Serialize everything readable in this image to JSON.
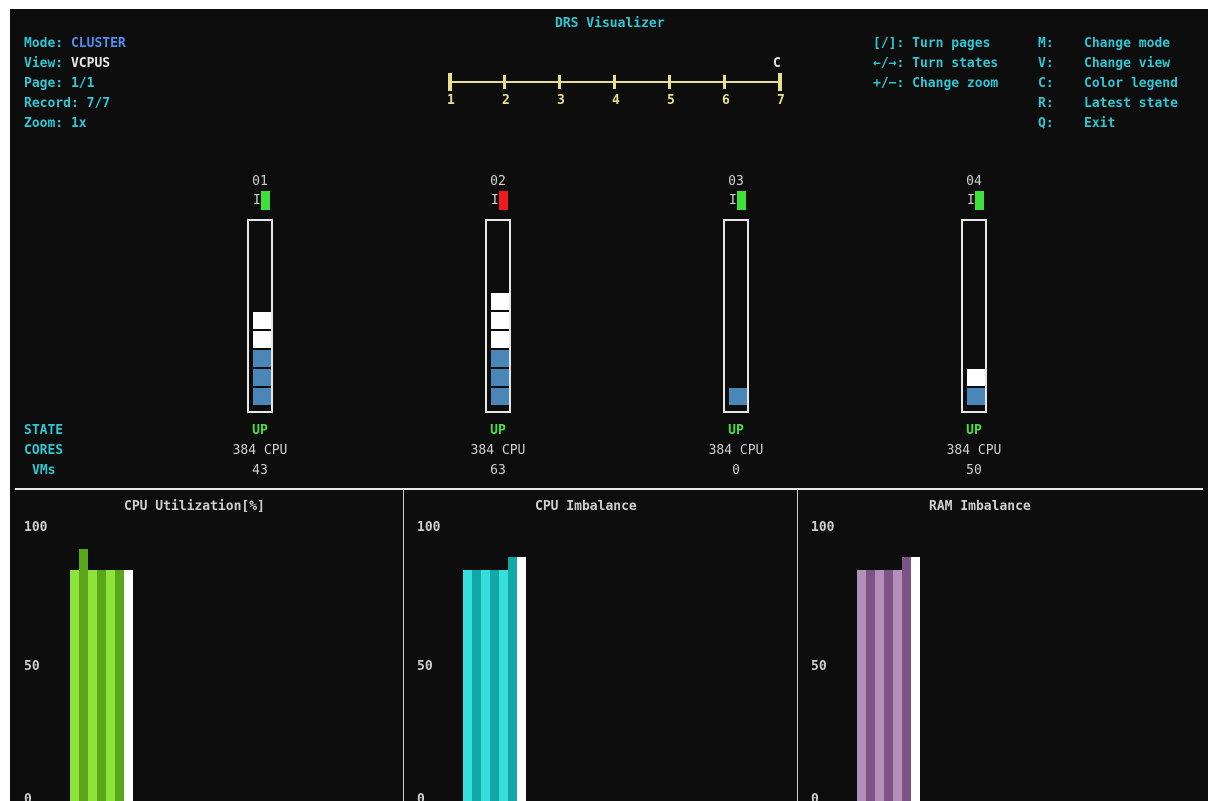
{
  "title": "DRS Visualizer",
  "status": {
    "mode_label": "Mode:",
    "mode_value": "CLUSTER",
    "view_label": "View:",
    "view_value": "VCPUS",
    "page_label": "Page:",
    "page_value": "1/1",
    "record_label": "Record:",
    "record_value": "7/7",
    "zoom_label": "Zoom:",
    "zoom_value": "1x"
  },
  "timeline": {
    "current_marker": "C",
    "ticks": [
      "1",
      "2",
      "3",
      "4",
      "5",
      "6",
      "7"
    ],
    "current_index": 7
  },
  "keys_left": [
    {
      "key": "[/]:",
      "action": "Turn pages"
    },
    {
      "key": "←/→:",
      "action": "Turn states"
    },
    {
      "key": "+/−:",
      "action": "Change zoom"
    }
  ],
  "keys_right": [
    {
      "key": "M:",
      "action": "Change mode"
    },
    {
      "key": "V:",
      "action": "Change view"
    },
    {
      "key": "C:",
      "action": "Color legend"
    },
    {
      "key": "R:",
      "action": "Latest state"
    },
    {
      "key": "Q:",
      "action": "Exit"
    }
  ],
  "row_labels": {
    "state": "STATE",
    "cores": "CORES",
    "vms": "VMs"
  },
  "hosts": [
    {
      "id": "01",
      "flag": "I",
      "indicator_color": "#3ee03a",
      "state": "UP",
      "cores": "384 CPU",
      "vms": "43",
      "blocks": [
        "w",
        "w",
        "b",
        "b",
        "b"
      ]
    },
    {
      "id": "02",
      "flag": "I",
      "indicator_color": "#ee1c1c",
      "state": "UP",
      "cores": "384 CPU",
      "vms": "63",
      "blocks": [
        "w",
        "w",
        "w",
        "b",
        "b",
        "b"
      ]
    },
    {
      "id": "03",
      "flag": "I",
      "indicator_color": "#3ee03a",
      "state": "UP",
      "cores": "384 CPU",
      "vms": "0",
      "blocks": [
        "b"
      ]
    },
    {
      "id": "04",
      "flag": "I",
      "indicator_color": "#3ee03a",
      "state": "UP",
      "cores": "384 CPU",
      "vms": "50",
      "blocks": [
        "w",
        "b"
      ]
    }
  ],
  "charts": [
    {
      "title": "CPU Utilization[%]",
      "ticks": [
        "100",
        "50",
        "0"
      ],
      "ylim": [
        0,
        100
      ],
      "colors": [
        "#8ee23c",
        "#5ca61b",
        "#8ee23c",
        "#5ca61b",
        "#8ee23c",
        "#5ca61b",
        "#ffffff"
      ],
      "values": [
        90,
        98,
        90,
        90,
        90,
        90,
        90
      ]
    },
    {
      "title": "CPU Imbalance",
      "ticks": [
        "100",
        "50",
        "0"
      ],
      "ylim": [
        0,
        100
      ],
      "colors": [
        "#35dedb",
        "#12a7a7",
        "#35dedb",
        "#12a7a7",
        "#35dedb",
        "#12a7a7",
        "#ffffff"
      ],
      "values": [
        90,
        90,
        90,
        90,
        90,
        95,
        95
      ]
    },
    {
      "title": "RAM Imbalance",
      "ticks": [
        "100",
        "50",
        "0"
      ],
      "ylim": [
        0,
        100
      ],
      "colors": [
        "#b48fb9",
        "#7c5486",
        "#b48fb9",
        "#7c5486",
        "#b48fb9",
        "#7c5486",
        "#ffffff"
      ],
      "values": [
        90,
        90,
        90,
        90,
        90,
        95,
        95
      ]
    }
  ]
}
